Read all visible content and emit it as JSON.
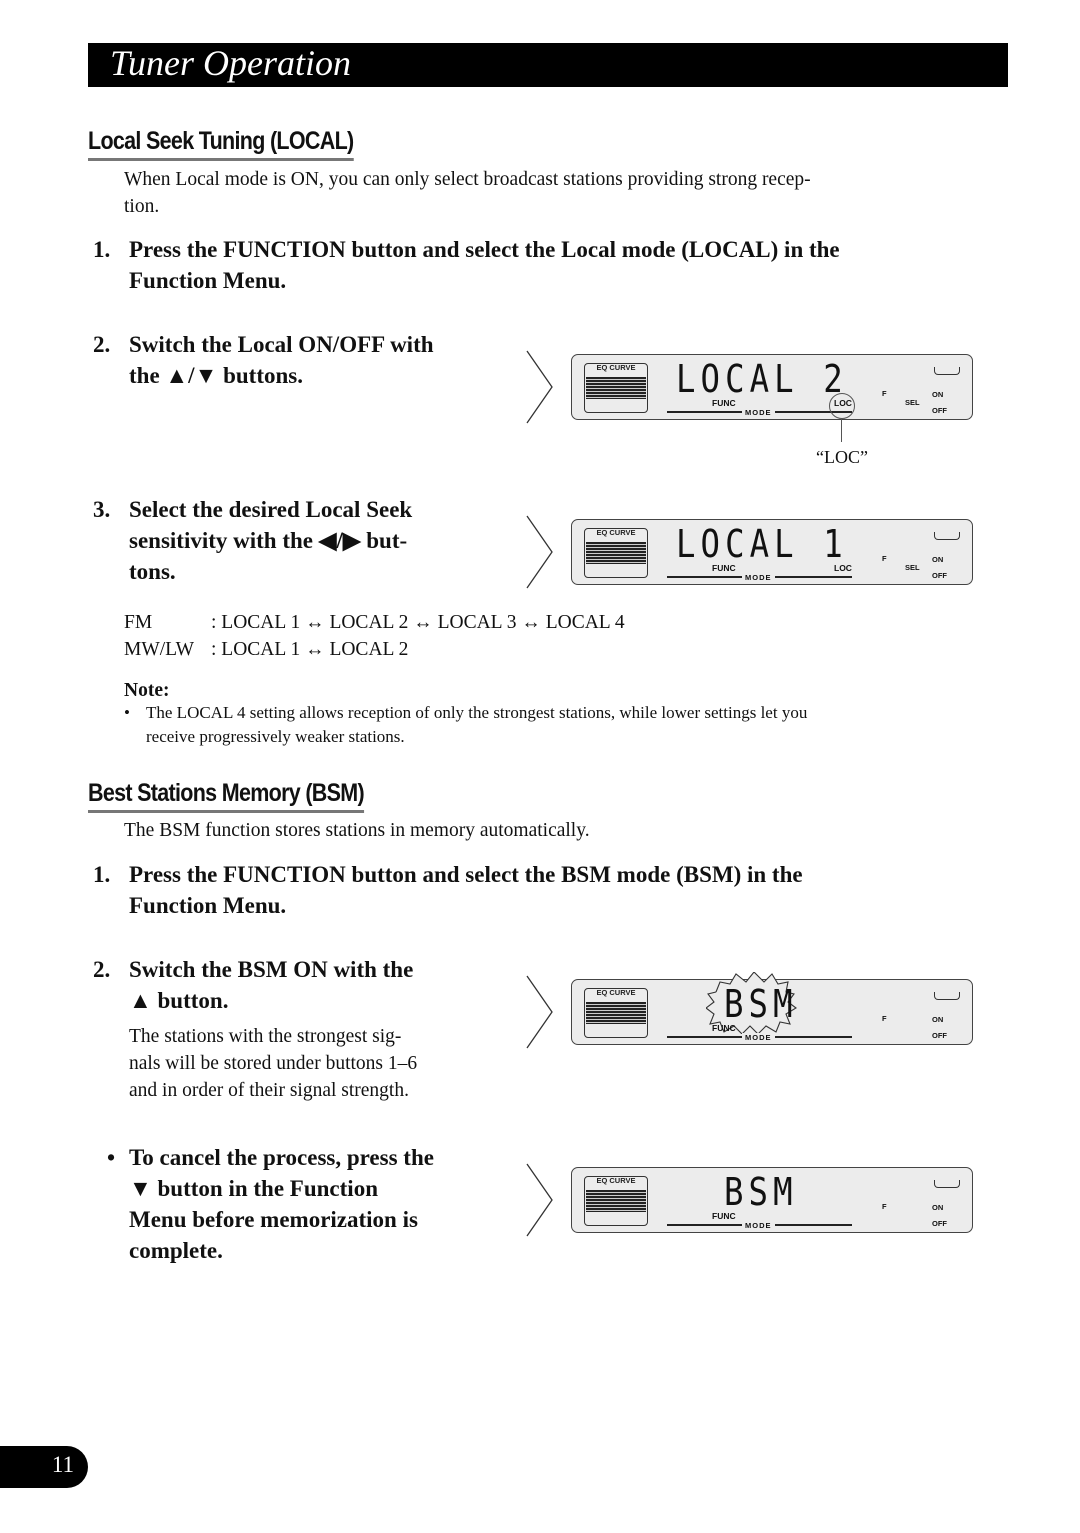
{
  "header": {
    "title": "Tuner Operation"
  },
  "local_section": {
    "heading": "Local Seek Tuning (LOCAL)",
    "intro_line1": "When Local mode is ON, you can only select broadcast stations providing strong recep-",
    "intro_line2": "tion.",
    "step1": {
      "num": "1.",
      "line1": "Press the FUNCTION button and select the Local mode (LOCAL) in the",
      "line2": "Function Menu."
    },
    "step2": {
      "num": "2.",
      "line1": "Switch the Local ON/OFF with",
      "line2": "the ▲/▼ buttons."
    },
    "step3": {
      "num": "3.",
      "line1": "Select the desired Local Seek",
      "line2": "sensitivity with the ◀/▶ but-",
      "line3": "tons."
    },
    "display1": {
      "text": "LOCAL 2",
      "eq_label": "EQ CURVE",
      "func": "FUNC",
      "mode": "MODE",
      "loc": "LOC",
      "f": "F",
      "sel": "SEL",
      "on": "ON",
      "off": "OFF"
    },
    "callout": "“LOC”",
    "display2": {
      "text": "LOCAL 1",
      "eq_label": "EQ CURVE",
      "func": "FUNC",
      "mode": "MODE",
      "loc": "LOC",
      "f": "F",
      "sel": "SEL",
      "on": "ON",
      "off": "OFF"
    },
    "fm_label": "FM",
    "fm_values": ": LOCAL 1 ↔ LOCAL 2 ↔ LOCAL 3 ↔ LOCAL 4",
    "mwlw_label": "MW/LW",
    "mwlw_values": ": LOCAL 1 ↔ LOCAL 2",
    "note_label": "Note:",
    "note_line1": "The LOCAL 4 setting allows reception of only the strongest stations, while lower settings let you",
    "note_line2": "receive progressively weaker stations."
  },
  "bsm_section": {
    "heading": "Best Stations Memory (BSM)",
    "intro": "The BSM function stores stations in memory automatically.",
    "step1": {
      "num": "1.",
      "line1": "Press the FUNCTION button and select the BSM mode (BSM) in the",
      "line2": "Function Menu."
    },
    "step2": {
      "num": "2.",
      "line1": "Switch the BSM ON with the",
      "line2": "▲ button."
    },
    "step2_desc": [
      "The stations with the strongest sig-",
      "nals will be stored under buttons 1–6",
      "and in order of their signal strength."
    ],
    "cancel": {
      "bullet": "•",
      "line1": "To cancel the process, press the",
      "line2": "▼  button in the Function",
      "line3": "Menu before memorization is",
      "line4": "complete."
    },
    "display3": {
      "text": "BSM",
      "eq_label": "EQ CURVE",
      "func": "FUNC",
      "mode": "MODE",
      "f": "F",
      "on": "ON",
      "off": "OFF",
      "state": "blinking"
    },
    "display4": {
      "text": "BSM",
      "eq_label": "EQ CURVE",
      "func": "FUNC",
      "mode": "MODE",
      "f": "F",
      "on": "ON",
      "off": "OFF"
    }
  },
  "footer": {
    "page_number": "11"
  }
}
